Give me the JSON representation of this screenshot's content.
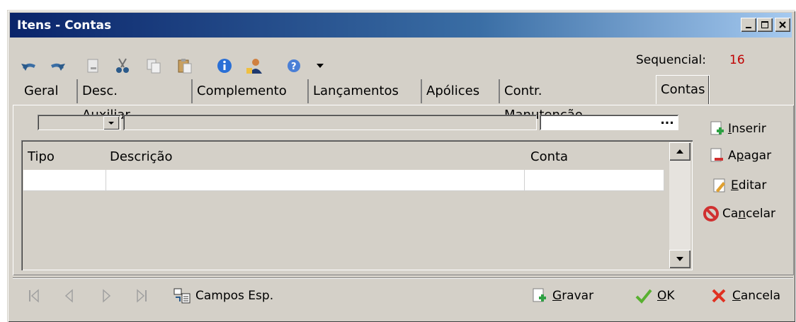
{
  "window": {
    "title": "Itens - Contas"
  },
  "toolbar": {
    "icons": [
      "undo-icon",
      "redo-icon",
      "new-document-icon",
      "cut-icon",
      "copy-icon",
      "paste-icon",
      "info-icon",
      "user-icon",
      "help-icon",
      "dropdown-arrow-icon"
    ],
    "sequencial_label": "Sequencial:",
    "sequencial_value": "16"
  },
  "tabs": [
    {
      "label": "Geral"
    },
    {
      "label": "Desc. Auxiliar"
    },
    {
      "label": "Complemento"
    },
    {
      "label": "Lançamentos"
    },
    {
      "label": "Apólices"
    },
    {
      "label": "Contr. Manutenção"
    },
    {
      "label": "Contas",
      "active": true
    }
  ],
  "form": {
    "tipo_value": "",
    "descricao_value": "",
    "conta_value": "",
    "lookup_button": "..."
  },
  "grid": {
    "columns": [
      "Tipo",
      "Descrição",
      "Conta"
    ],
    "rows": [
      [
        "",
        "",
        ""
      ]
    ]
  },
  "side_buttons": {
    "insert": {
      "prefix": "",
      "accel": "I",
      "rest": "nserir"
    },
    "delete": {
      "prefix": "A",
      "accel": "p",
      "rest": "agar"
    },
    "edit": {
      "prefix": "",
      "accel": "E",
      "rest": "ditar"
    },
    "cancel": {
      "prefix": "Ca",
      "accel": "n",
      "rest": "celar"
    }
  },
  "footer": {
    "campos_esp": "Campos Esp.",
    "save": {
      "accel": "G",
      "rest": "ravar"
    },
    "ok": {
      "accel": "O",
      "rest": "K"
    },
    "cancel": {
      "accel": "C",
      "rest": "ancela"
    }
  },
  "colors": {
    "title_start": "#0a246a",
    "title_end": "#a6caf0",
    "face": "#d4d0c8",
    "sequencial_value": "#c00000"
  }
}
